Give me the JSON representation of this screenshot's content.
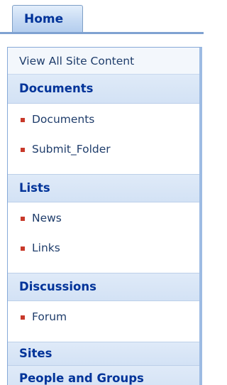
{
  "tab": {
    "label": "Home"
  },
  "quicklaunch": {
    "view_all": "View All Site Content",
    "sections": [
      {
        "header": "Documents",
        "items": [
          "Documents",
          "Submit_Folder"
        ]
      },
      {
        "header": "Lists",
        "items": [
          "News",
          "Links"
        ]
      },
      {
        "header": "Discussions",
        "items": [
          "Forum"
        ]
      },
      {
        "header": "Sites",
        "items": []
      },
      {
        "header": "People and Groups",
        "items": []
      }
    ]
  },
  "colors": {
    "header_text": "#003399",
    "item_text": "#1f3d6b",
    "bullet": "#c8392a",
    "header_bg": "#d9e6f7",
    "border": "#86a9d8"
  }
}
